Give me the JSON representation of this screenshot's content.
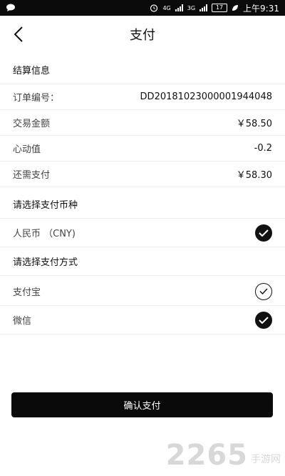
{
  "status_bar": {
    "network1": "4G",
    "network2": "3G",
    "battery": "17",
    "time": "上午9:31"
  },
  "nav": {
    "title": "支付"
  },
  "settlement": {
    "header": "结算信息",
    "rows": [
      {
        "label": "订单编号：",
        "value": "DD20181023000001944048"
      },
      {
        "label": "交易金额",
        "value": "￥58.50"
      },
      {
        "label": "心动值",
        "value": "-0.2"
      },
      {
        "label": "还需支付",
        "value": "￥58.30"
      }
    ]
  },
  "currency": {
    "header": "请选择支付币种",
    "options": [
      {
        "label": "人民币 （CNY)",
        "selected": true
      }
    ]
  },
  "method": {
    "header": "请选择支付方式",
    "options": [
      {
        "label": "支付宝",
        "selected": false
      },
      {
        "label": "微信",
        "selected": true
      }
    ]
  },
  "confirm_label": "确认支付",
  "watermark": {
    "main": "2265",
    "sub": "手游网"
  }
}
